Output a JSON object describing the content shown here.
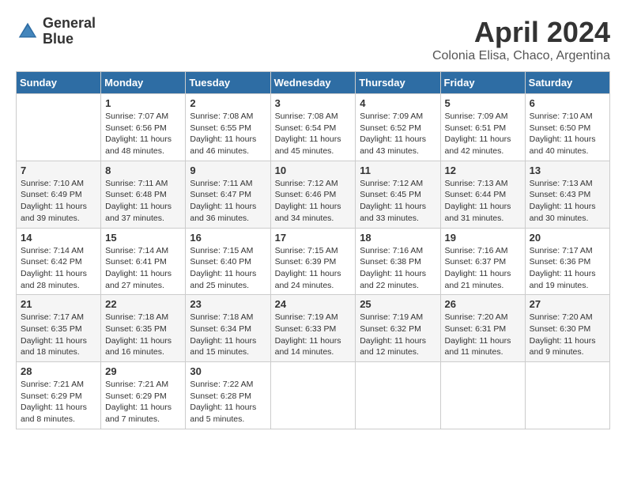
{
  "logo": {
    "line1": "General",
    "line2": "Blue"
  },
  "title": "April 2024",
  "subtitle": "Colonia Elisa, Chaco, Argentina",
  "weekdays": [
    "Sunday",
    "Monday",
    "Tuesday",
    "Wednesday",
    "Thursday",
    "Friday",
    "Saturday"
  ],
  "weeks": [
    [
      {
        "day": "",
        "sunrise": "",
        "sunset": "",
        "daylight": ""
      },
      {
        "day": "1",
        "sunrise": "Sunrise: 7:07 AM",
        "sunset": "Sunset: 6:56 PM",
        "daylight": "Daylight: 11 hours and 48 minutes."
      },
      {
        "day": "2",
        "sunrise": "Sunrise: 7:08 AM",
        "sunset": "Sunset: 6:55 PM",
        "daylight": "Daylight: 11 hours and 46 minutes."
      },
      {
        "day": "3",
        "sunrise": "Sunrise: 7:08 AM",
        "sunset": "Sunset: 6:54 PM",
        "daylight": "Daylight: 11 hours and 45 minutes."
      },
      {
        "day": "4",
        "sunrise": "Sunrise: 7:09 AM",
        "sunset": "Sunset: 6:52 PM",
        "daylight": "Daylight: 11 hours and 43 minutes."
      },
      {
        "day": "5",
        "sunrise": "Sunrise: 7:09 AM",
        "sunset": "Sunset: 6:51 PM",
        "daylight": "Daylight: 11 hours and 42 minutes."
      },
      {
        "day": "6",
        "sunrise": "Sunrise: 7:10 AM",
        "sunset": "Sunset: 6:50 PM",
        "daylight": "Daylight: 11 hours and 40 minutes."
      }
    ],
    [
      {
        "day": "7",
        "sunrise": "Sunrise: 7:10 AM",
        "sunset": "Sunset: 6:49 PM",
        "daylight": "Daylight: 11 hours and 39 minutes."
      },
      {
        "day": "8",
        "sunrise": "Sunrise: 7:11 AM",
        "sunset": "Sunset: 6:48 PM",
        "daylight": "Daylight: 11 hours and 37 minutes."
      },
      {
        "day": "9",
        "sunrise": "Sunrise: 7:11 AM",
        "sunset": "Sunset: 6:47 PM",
        "daylight": "Daylight: 11 hours and 36 minutes."
      },
      {
        "day": "10",
        "sunrise": "Sunrise: 7:12 AM",
        "sunset": "Sunset: 6:46 PM",
        "daylight": "Daylight: 11 hours and 34 minutes."
      },
      {
        "day": "11",
        "sunrise": "Sunrise: 7:12 AM",
        "sunset": "Sunset: 6:45 PM",
        "daylight": "Daylight: 11 hours and 33 minutes."
      },
      {
        "day": "12",
        "sunrise": "Sunrise: 7:13 AM",
        "sunset": "Sunset: 6:44 PM",
        "daylight": "Daylight: 11 hours and 31 minutes."
      },
      {
        "day": "13",
        "sunrise": "Sunrise: 7:13 AM",
        "sunset": "Sunset: 6:43 PM",
        "daylight": "Daylight: 11 hours and 30 minutes."
      }
    ],
    [
      {
        "day": "14",
        "sunrise": "Sunrise: 7:14 AM",
        "sunset": "Sunset: 6:42 PM",
        "daylight": "Daylight: 11 hours and 28 minutes."
      },
      {
        "day": "15",
        "sunrise": "Sunrise: 7:14 AM",
        "sunset": "Sunset: 6:41 PM",
        "daylight": "Daylight: 11 hours and 27 minutes."
      },
      {
        "day": "16",
        "sunrise": "Sunrise: 7:15 AM",
        "sunset": "Sunset: 6:40 PM",
        "daylight": "Daylight: 11 hours and 25 minutes."
      },
      {
        "day": "17",
        "sunrise": "Sunrise: 7:15 AM",
        "sunset": "Sunset: 6:39 PM",
        "daylight": "Daylight: 11 hours and 24 minutes."
      },
      {
        "day": "18",
        "sunrise": "Sunrise: 7:16 AM",
        "sunset": "Sunset: 6:38 PM",
        "daylight": "Daylight: 11 hours and 22 minutes."
      },
      {
        "day": "19",
        "sunrise": "Sunrise: 7:16 AM",
        "sunset": "Sunset: 6:37 PM",
        "daylight": "Daylight: 11 hours and 21 minutes."
      },
      {
        "day": "20",
        "sunrise": "Sunrise: 7:17 AM",
        "sunset": "Sunset: 6:36 PM",
        "daylight": "Daylight: 11 hours and 19 minutes."
      }
    ],
    [
      {
        "day": "21",
        "sunrise": "Sunrise: 7:17 AM",
        "sunset": "Sunset: 6:35 PM",
        "daylight": "Daylight: 11 hours and 18 minutes."
      },
      {
        "day": "22",
        "sunrise": "Sunrise: 7:18 AM",
        "sunset": "Sunset: 6:35 PM",
        "daylight": "Daylight: 11 hours and 16 minutes."
      },
      {
        "day": "23",
        "sunrise": "Sunrise: 7:18 AM",
        "sunset": "Sunset: 6:34 PM",
        "daylight": "Daylight: 11 hours and 15 minutes."
      },
      {
        "day": "24",
        "sunrise": "Sunrise: 7:19 AM",
        "sunset": "Sunset: 6:33 PM",
        "daylight": "Daylight: 11 hours and 14 minutes."
      },
      {
        "day": "25",
        "sunrise": "Sunrise: 7:19 AM",
        "sunset": "Sunset: 6:32 PM",
        "daylight": "Daylight: 11 hours and 12 minutes."
      },
      {
        "day": "26",
        "sunrise": "Sunrise: 7:20 AM",
        "sunset": "Sunset: 6:31 PM",
        "daylight": "Daylight: 11 hours and 11 minutes."
      },
      {
        "day": "27",
        "sunrise": "Sunrise: 7:20 AM",
        "sunset": "Sunset: 6:30 PM",
        "daylight": "Daylight: 11 hours and 9 minutes."
      }
    ],
    [
      {
        "day": "28",
        "sunrise": "Sunrise: 7:21 AM",
        "sunset": "Sunset: 6:29 PM",
        "daylight": "Daylight: 11 hours and 8 minutes."
      },
      {
        "day": "29",
        "sunrise": "Sunrise: 7:21 AM",
        "sunset": "Sunset: 6:29 PM",
        "daylight": "Daylight: 11 hours and 7 minutes."
      },
      {
        "day": "30",
        "sunrise": "Sunrise: 7:22 AM",
        "sunset": "Sunset: 6:28 PM",
        "daylight": "Daylight: 11 hours and 5 minutes."
      },
      {
        "day": "",
        "sunrise": "",
        "sunset": "",
        "daylight": ""
      },
      {
        "day": "",
        "sunrise": "",
        "sunset": "",
        "daylight": ""
      },
      {
        "day": "",
        "sunrise": "",
        "sunset": "",
        "daylight": ""
      },
      {
        "day": "",
        "sunrise": "",
        "sunset": "",
        "daylight": ""
      }
    ]
  ]
}
